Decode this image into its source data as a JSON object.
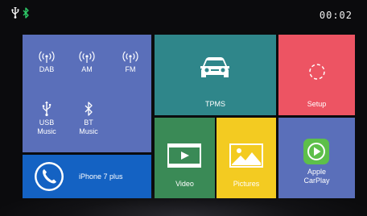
{
  "status": {
    "time": "00:02",
    "usb_icon": "usb-icon",
    "bluetooth_icon": "bluetooth-icon",
    "bluetooth_color": "#2fcf6a"
  },
  "radio": {
    "dab": "DAB",
    "am": "AM",
    "fm": "FM",
    "usb_music": "USB\nMusic",
    "bt_music": "BT\nMusic"
  },
  "phone": {
    "device_name": "iPhone 7 plus"
  },
  "tiles": {
    "tpms": "TPMS",
    "setup": "Setup",
    "video": "Video",
    "pictures": "Pictures",
    "carplay": "Apple\nCarPlay"
  },
  "colors": {
    "radio_panel": "#5a6fba",
    "phone_panel": "#1462c3",
    "tpms": "#2f868a",
    "setup": "#ed5463",
    "video": "#3a8a56",
    "pictures": "#f3cb21",
    "carplay": "#5a6fba",
    "carplay_icon": "#5dbf4a"
  }
}
